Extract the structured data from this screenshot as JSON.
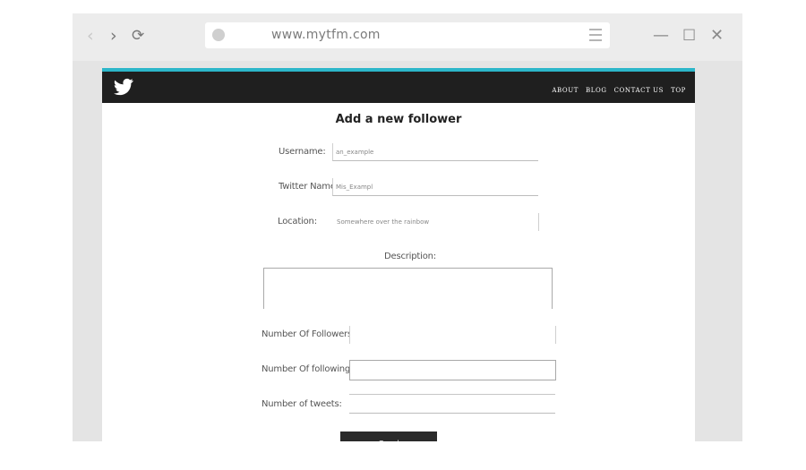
{
  "browser": {
    "url": "www.mytfm.com",
    "icons": [
      "back-arrow-icon",
      "forward-arrow-icon",
      "reload-icon",
      "globe-icon",
      "menu-icon",
      "minimize-icon",
      "maximize-icon",
      "close-icon"
    ]
  },
  "site": {
    "accent_color": "#2cb6c9",
    "header_color": "#1f1f1f",
    "nav": [
      "ABOUT",
      "BLOG",
      "CONTACT US",
      "TOP"
    ]
  },
  "form": {
    "title": "Add a new follower",
    "username": {
      "label": "Username:",
      "placeholder": "an_example"
    },
    "twitter_name": {
      "label": "Twitter Name:",
      "placeholder": "Mis_Exampl"
    },
    "location": {
      "label": "Location:",
      "placeholder": "Somewhere over the rainbow"
    },
    "description": {
      "label": "Description:"
    },
    "followers": {
      "label": "Number Of Followers:"
    },
    "following": {
      "label": "Number Of following:"
    },
    "tweets": {
      "label": "Number of tweets:"
    },
    "submit_label": "Send"
  }
}
